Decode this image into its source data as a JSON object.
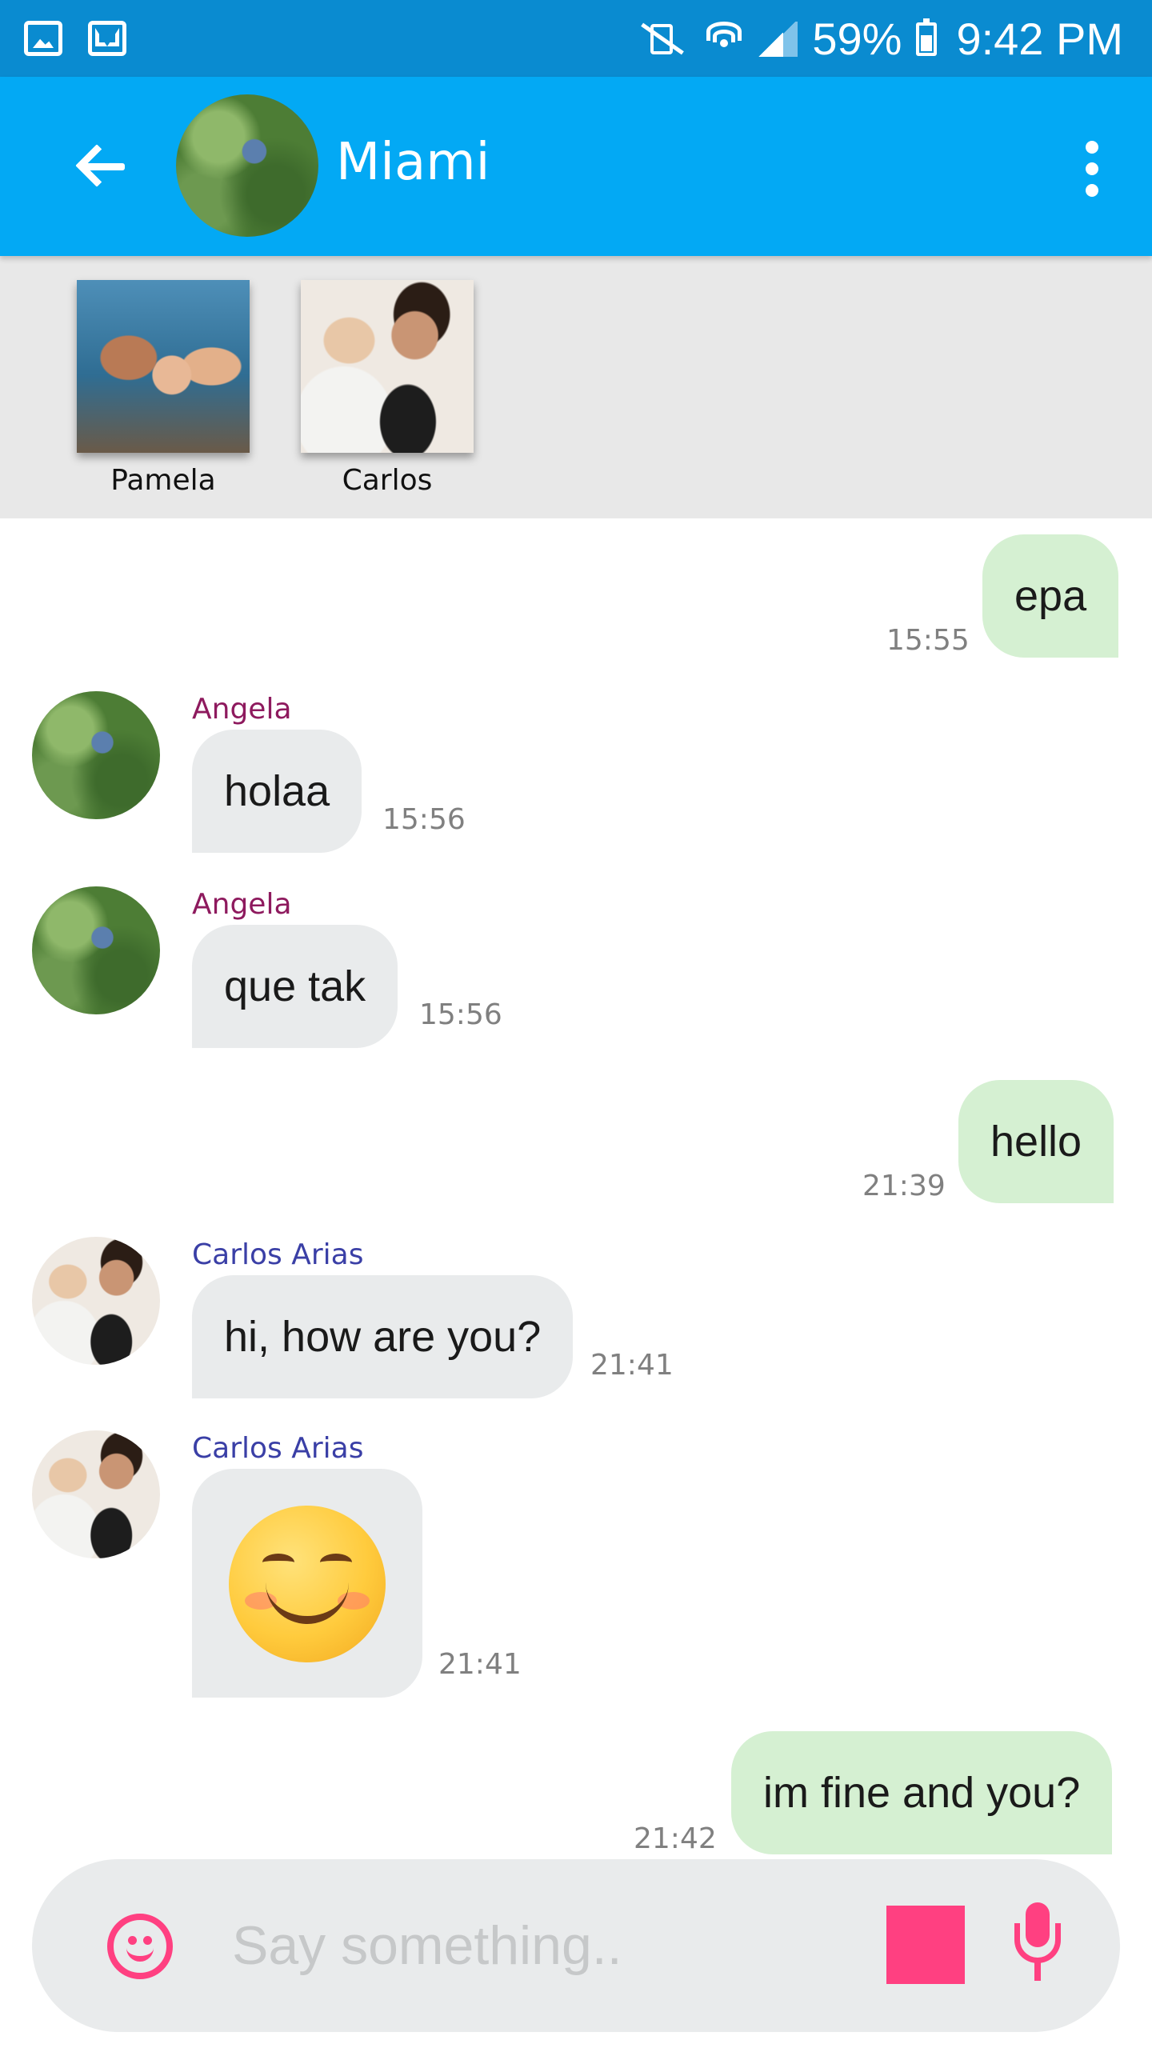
{
  "status_bar": {
    "icons": [
      "gallery-icon",
      "gmail-icon",
      "vibrate-icon",
      "wifi-icon",
      "signal-icon",
      "battery-icon"
    ],
    "battery": "59%",
    "time": "9:42 PM"
  },
  "header": {
    "title": "Miami",
    "back_icon": "arrow-left-icon",
    "menu_icon": "more-vert-icon"
  },
  "participants": [
    {
      "name": "Pamela"
    },
    {
      "name": "Carlos"
    }
  ],
  "messages": [
    {
      "direction": "out",
      "text": "epa",
      "time": "15:55"
    },
    {
      "direction": "in",
      "sender": "Angela",
      "text": "holaa",
      "time": "15:56"
    },
    {
      "direction": "in",
      "sender": "Angela",
      "text": "que tak",
      "time": "15:56"
    },
    {
      "direction": "out",
      "text": "hello",
      "time": "21:39"
    },
    {
      "direction": "in",
      "sender": "Carlos Arias",
      "text": "hi, how are you?",
      "time": "21:41"
    },
    {
      "direction": "in",
      "sender": "Carlos Arias",
      "emoji": "smiling-face-emoji",
      "time": "21:41"
    },
    {
      "direction": "out",
      "text": "im fine and you?",
      "time": "21:42"
    }
  ],
  "composer": {
    "placeholder": "Say something..",
    "value": ""
  },
  "colors": {
    "status_bar": "#0a8bd0",
    "app_bar": "#03a9f4",
    "outgoing_bubble": "#d5f0d2",
    "incoming_bubble": "#e9ebec",
    "accent": "#ff4081",
    "sender_angela": "#8e1a5e",
    "sender_carlos": "#3a3fa6"
  }
}
